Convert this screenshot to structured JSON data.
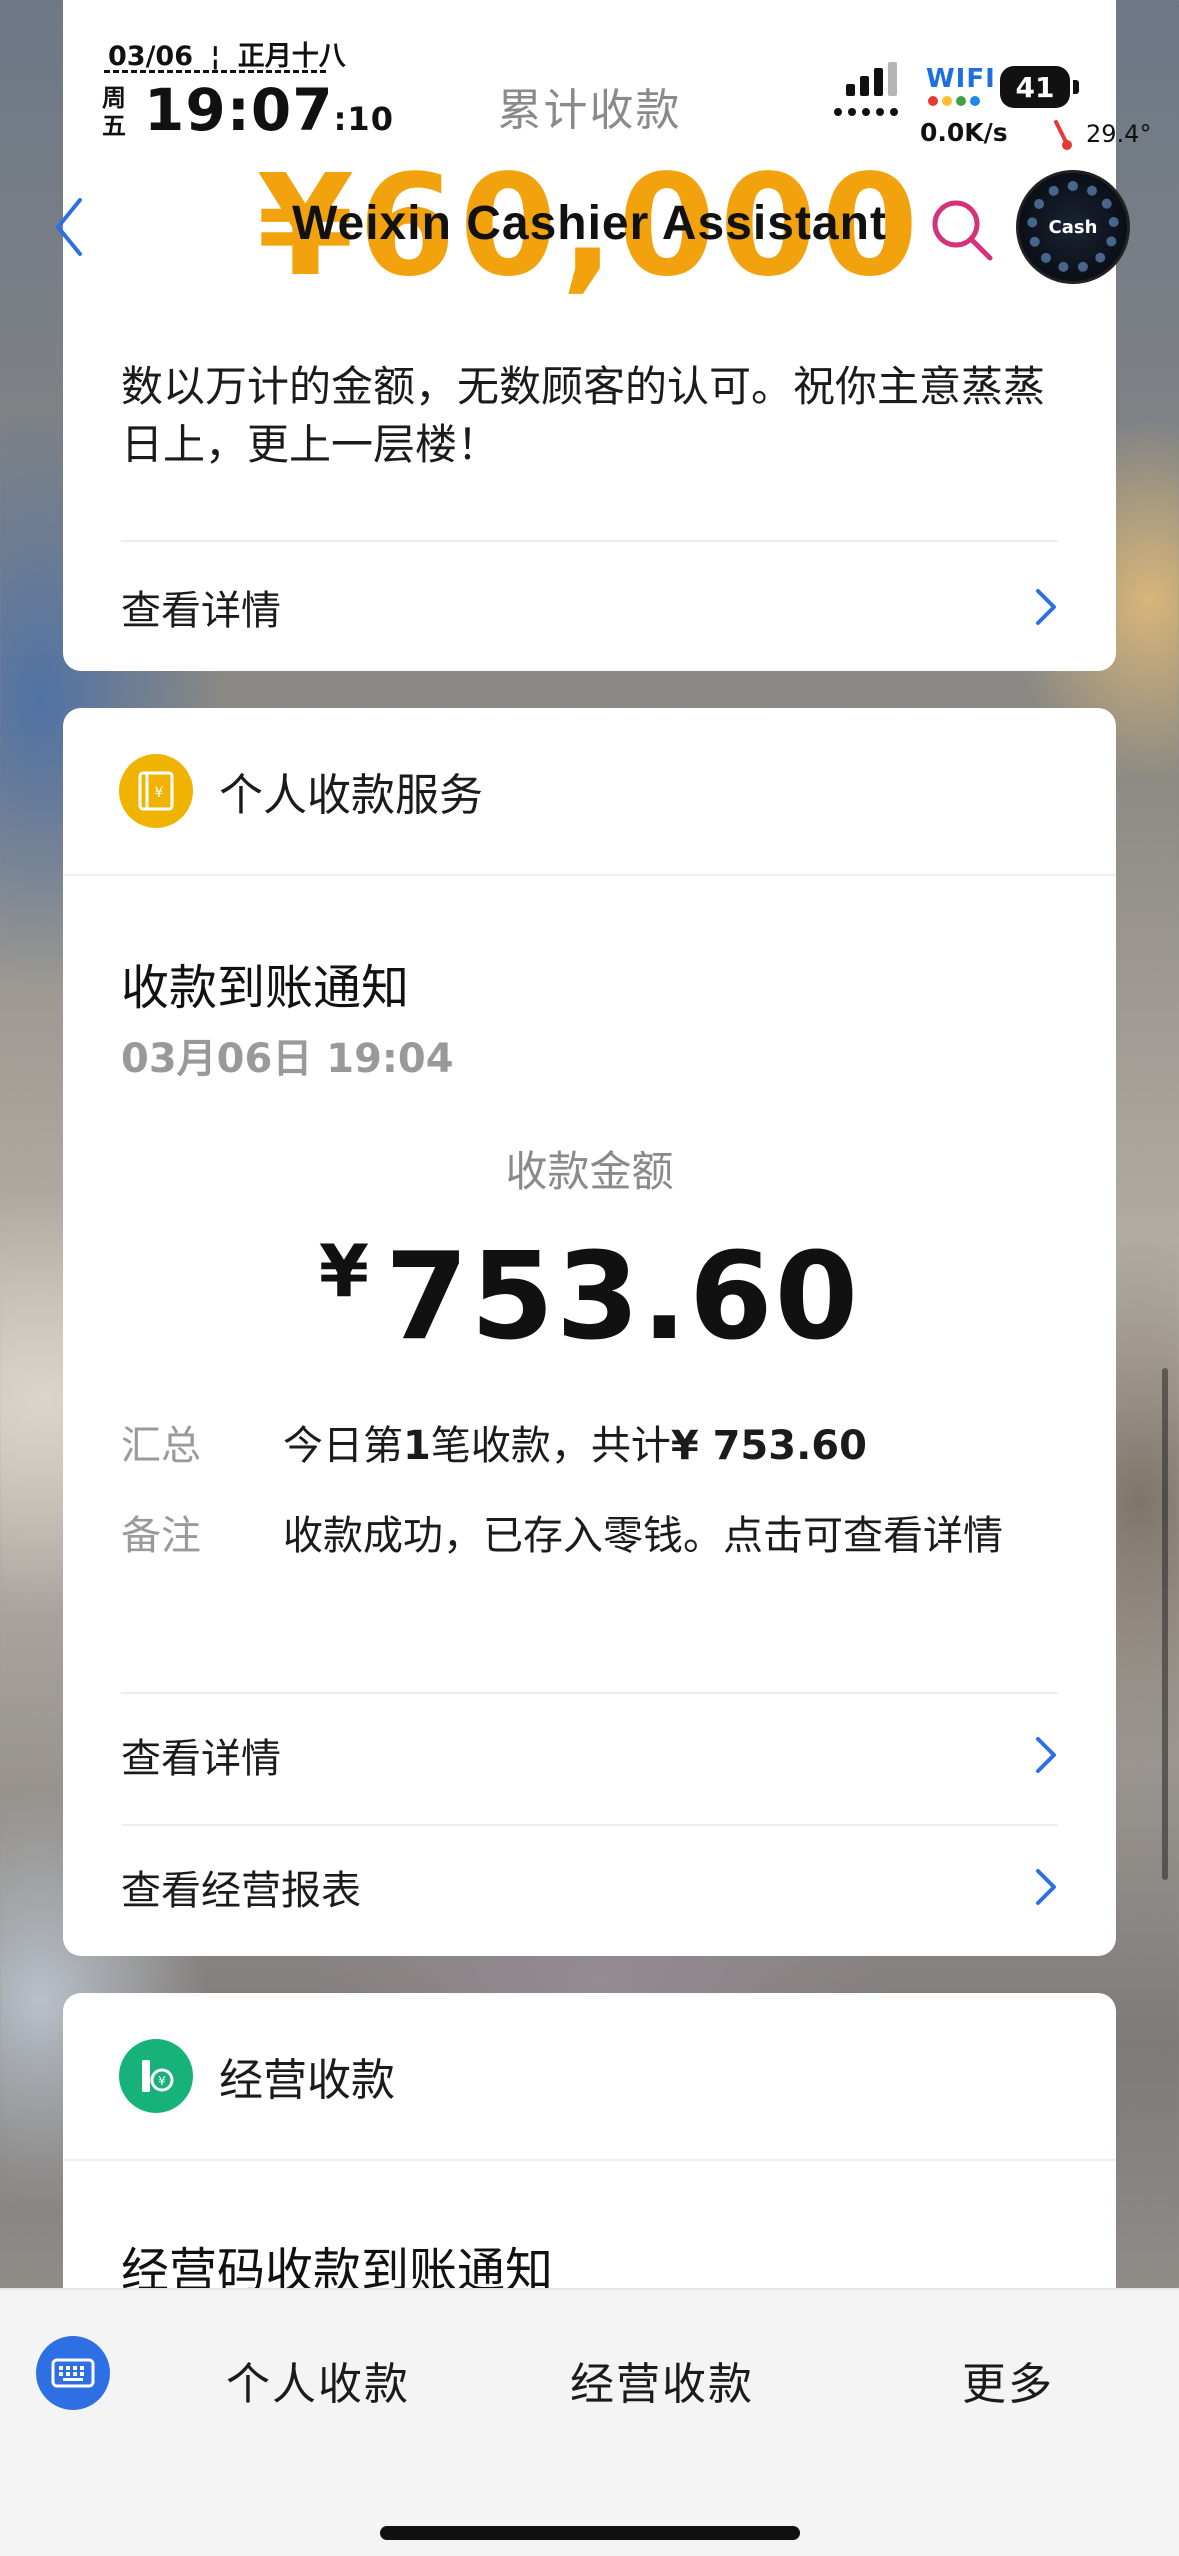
{
  "status_bar": {
    "date": "03/06",
    "lunar": "正月十八",
    "weekday": "周五",
    "time": "19:07",
    "seconds": ":10",
    "wifi_label": "WIFI",
    "battery": "41",
    "net_speed": "0.0K/s",
    "temperature": "29.4°"
  },
  "nav": {
    "title": "Weixin Cashier Assistant",
    "badge_label": "Cash"
  },
  "summary_card": {
    "label": "累计收款",
    "amount": "¥60,000",
    "message": "数以万计的金额，无数顾客的认可。祝你主意蒸蒸日上，更上一层楼！",
    "link_label": "查看详情"
  },
  "personal_card": {
    "title": "个人收款服务",
    "notice_title": "收款到账通知",
    "notice_time": "03月06日 19:04",
    "amount_label": "收款金额",
    "amount_currency": "¥",
    "amount_value": "753.60",
    "summary_key": "汇总",
    "summary_value_prefix": "今日第",
    "summary_count": "1",
    "summary_value_mid": "笔收款，共计",
    "summary_total": "¥ 753.60",
    "remark_key": "备注",
    "remark_value": "收款成功，已存入零钱。点击可查看详情",
    "link_details": "查看详情",
    "link_report": "查看经营报表"
  },
  "business_card": {
    "title": "经营收款",
    "notice_title": "经营码收款到账通知"
  },
  "tabbar": {
    "tabs": [
      "个人收款",
      "经营收款",
      "更多"
    ]
  },
  "colors": {
    "accent_orange": "#f2a20c",
    "icon_yellow": "#f0b400",
    "icon_green": "#17b17a",
    "link_blue": "#2f6fe4",
    "search_pink": "#d4327a"
  }
}
